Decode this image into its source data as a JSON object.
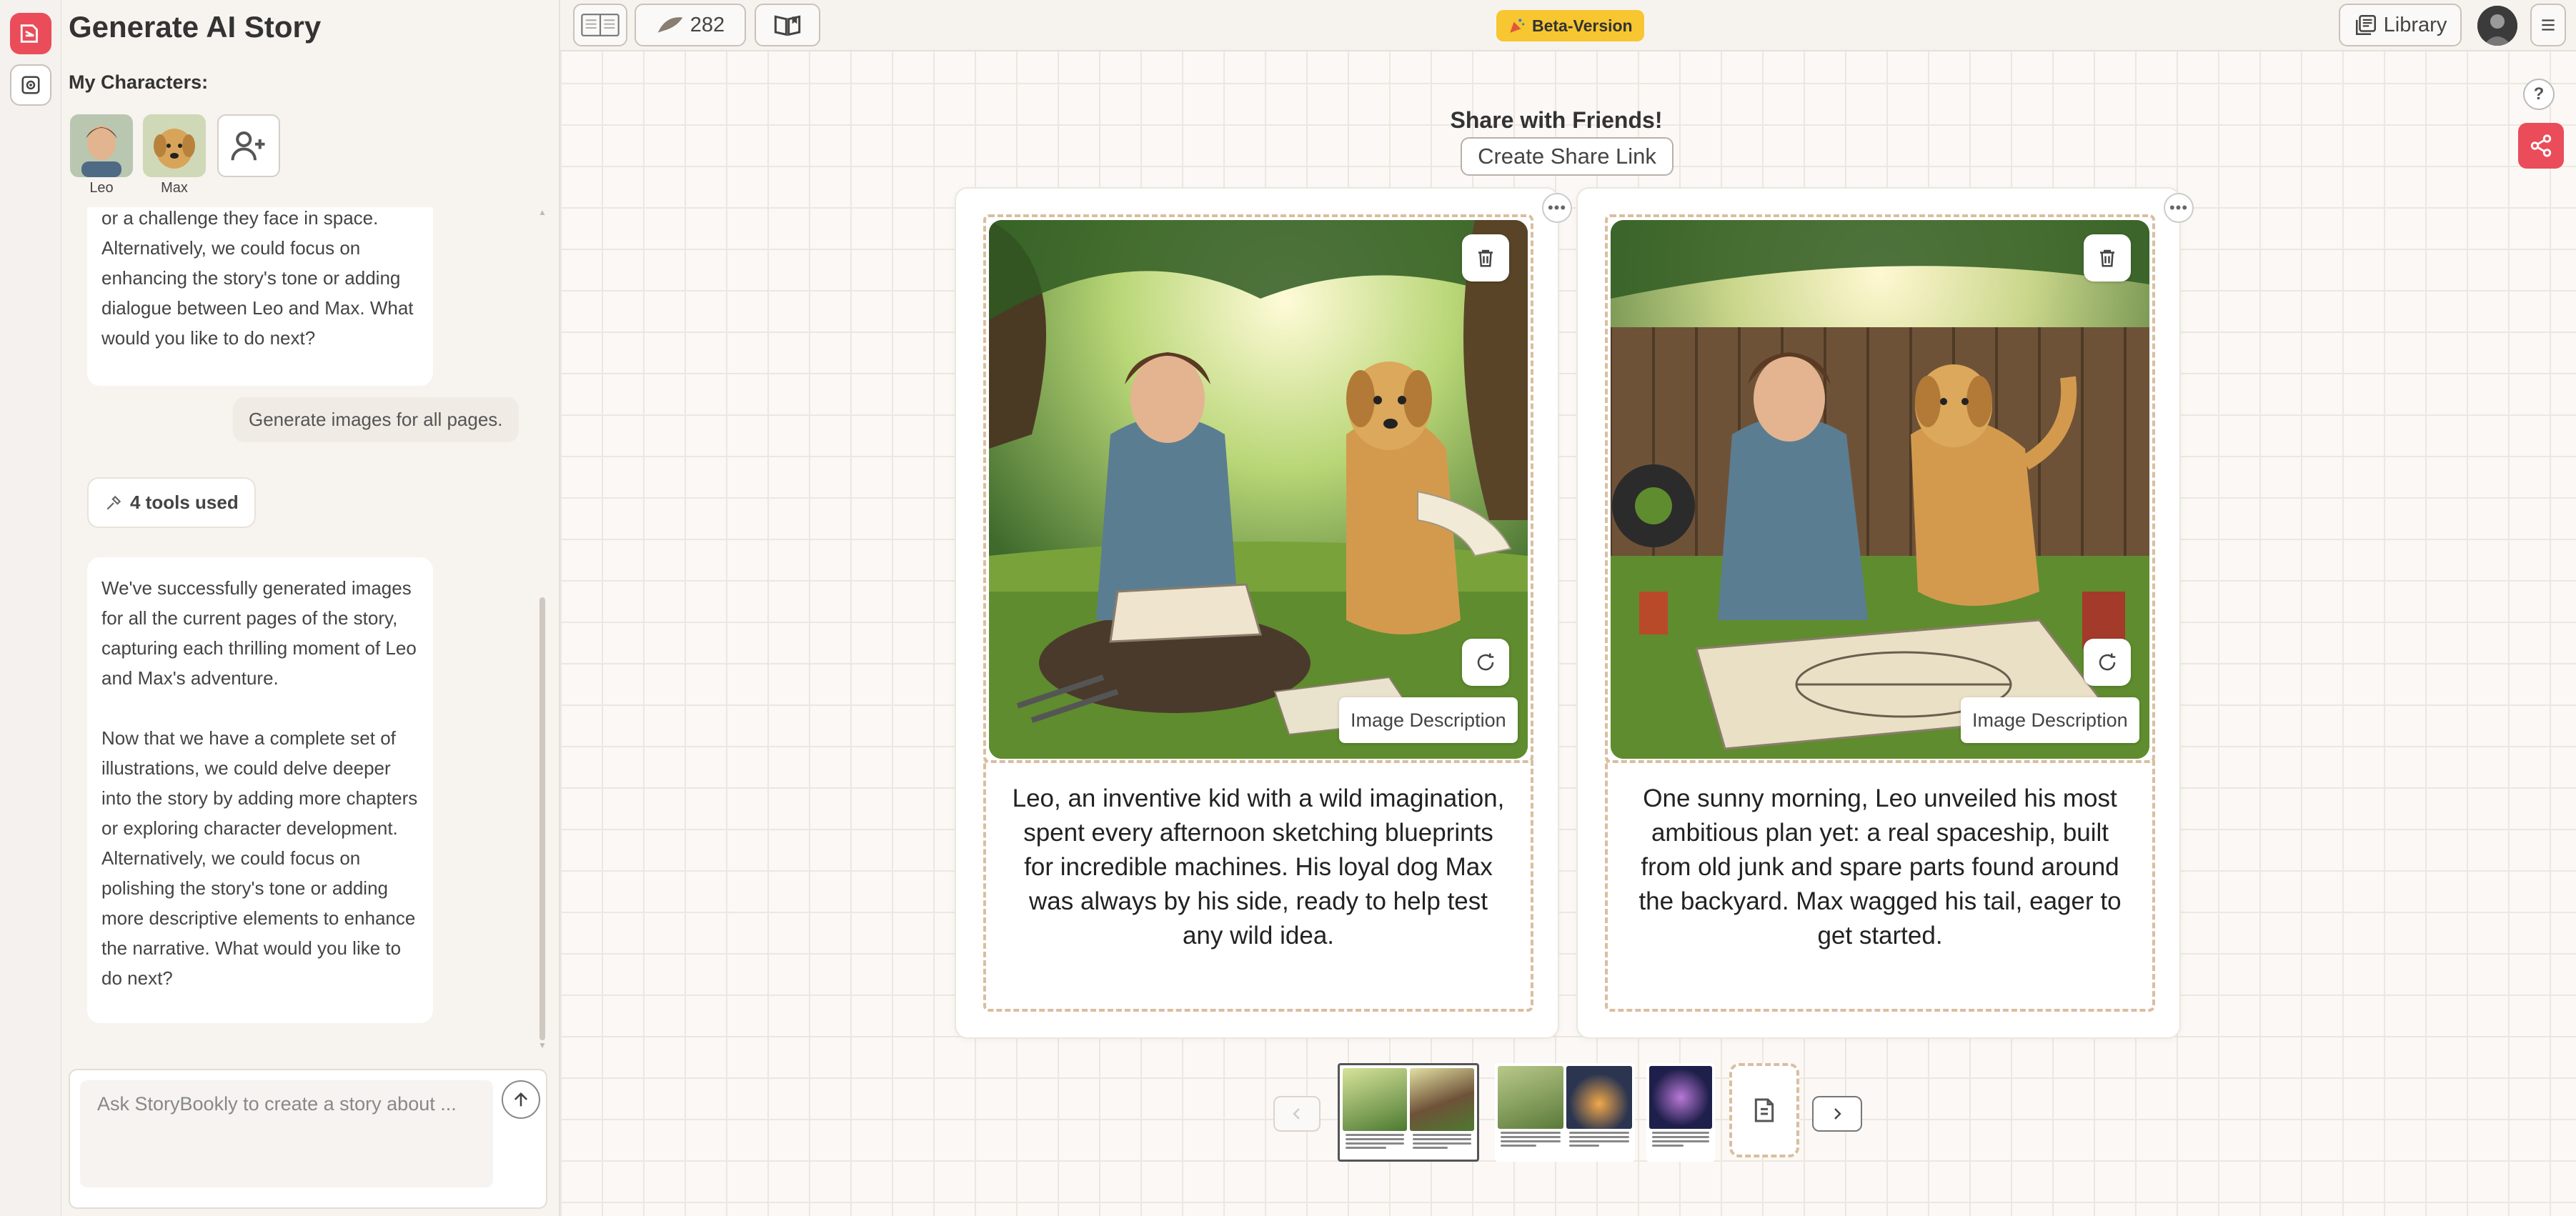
{
  "panel": {
    "title": "Generate AI Story",
    "characters_label": "My Characters:",
    "characters": [
      {
        "name": "Leo",
        "icon": "avatar-leo"
      },
      {
        "name": "Max",
        "icon": "avatar-max"
      }
    ]
  },
  "chat": {
    "message1_tail": "or a challenge they face in space. Alternatively, we could focus on enhancing the story's tone or adding dialogue between Leo and Max. What would you like to do next?",
    "user_message": "Generate images for all pages.",
    "tools_pill": "4 tools used",
    "message2_para1": "We've successfully generated images for all the current pages of the story, capturing each thrilling moment of Leo and Max's adventure.",
    "message2_para2": "Now that we have a complete set of illustrations, we could delve deeper into the story by adding more chapters or exploring character development. Alternatively, we could focus on polishing the story's tone or adding more descriptive elements to enhance the narrative. What would you like to do next?"
  },
  "composer": {
    "placeholder": "Ask StoryBookly to create a story about ..."
  },
  "topbar": {
    "credits": "282",
    "beta_label": "Beta-Version",
    "library_label": "Library"
  },
  "help_label": "?",
  "share": {
    "title": "Share with Friends!",
    "button": "Create Share Link"
  },
  "pages": [
    {
      "image_description_label": "Image Description",
      "text": "Leo, an inventive kid with a wild imagination, spent every afternoon sketching blueprints for incredible machines. His loyal dog Max was always by his side, ready to help test any wild idea."
    },
    {
      "image_description_label": "Image Description",
      "text": "One sunny morning, Leo unveiled his most ambitious plan yet: a real spaceship, built from old junk and spare parts found around the backyard. Max wagged his tail, eager to get started."
    }
  ],
  "colors": {
    "accent_red": "#ea4c5a",
    "beta_yellow": "#f7c630",
    "dashed_border": "#d9bea0"
  }
}
